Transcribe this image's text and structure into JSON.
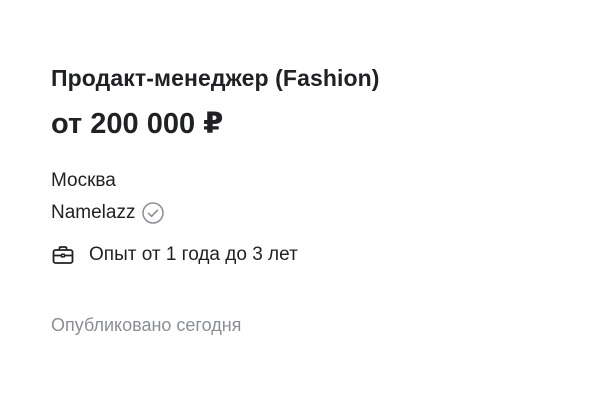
{
  "vacancy": {
    "title": "Продакт-менеджер (Fashion)",
    "salary": "от 200 000 ₽",
    "city": "Москва",
    "company": "Namelazz",
    "company_verified_icon": "check-circle-icon",
    "experience_icon": "briefcase-icon",
    "experience": "Опыт от 1 года до 3 лет",
    "published": "Опубликовано сегодня"
  },
  "colors": {
    "text_primary": "#1f2124",
    "text_secondary": "#8a8e94",
    "icon_muted": "#8a8e94",
    "background": "#ffffff"
  }
}
